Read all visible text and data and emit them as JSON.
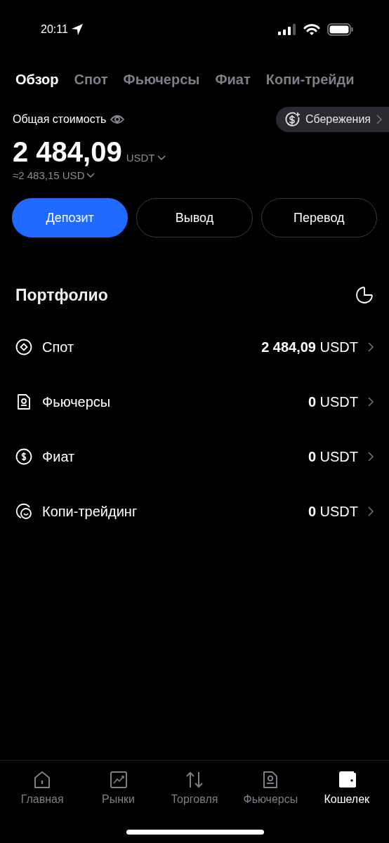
{
  "status_bar": {
    "time": "20:11"
  },
  "tabs": [
    {
      "label": "Обзор",
      "selected": true
    },
    {
      "label": "Спот",
      "selected": false
    },
    {
      "label": "Фьючерсы",
      "selected": false
    },
    {
      "label": "Фиат",
      "selected": false
    },
    {
      "label": "Копи-трейди",
      "selected": false
    }
  ],
  "balance": {
    "label": "Общая стоимость",
    "savings": "Сбережения",
    "amount": "2 484,09",
    "currency": "USDT",
    "approx": "≈2 483,15",
    "approx_currency": "USD"
  },
  "actions": [
    {
      "label": "Депозит",
      "kind": "primary"
    },
    {
      "label": "Вывод",
      "kind": "outline"
    },
    {
      "label": "Перевод",
      "kind": "outline"
    }
  ],
  "portfolio": {
    "title": "Портфолио",
    "items": [
      {
        "name": "Спот",
        "value": "**2 484,09** USDT"
      },
      {
        "name": "Фьючерсы",
        "value": "**0** USDT"
      },
      {
        "name": "Фиат",
        "value": "**0** USDT"
      },
      {
        "name": "Копи-трейдинг",
        "value": "**0** USDT"
      }
    ]
  },
  "bottom_nav": [
    {
      "label": "Главная",
      "selected": false
    },
    {
      "label": "Рынки",
      "selected": false
    },
    {
      "label": "Торговля",
      "selected": false
    },
    {
      "label": "Фьючерсы",
      "selected": false
    },
    {
      "label": "Кошелек",
      "selected": true
    }
  ]
}
